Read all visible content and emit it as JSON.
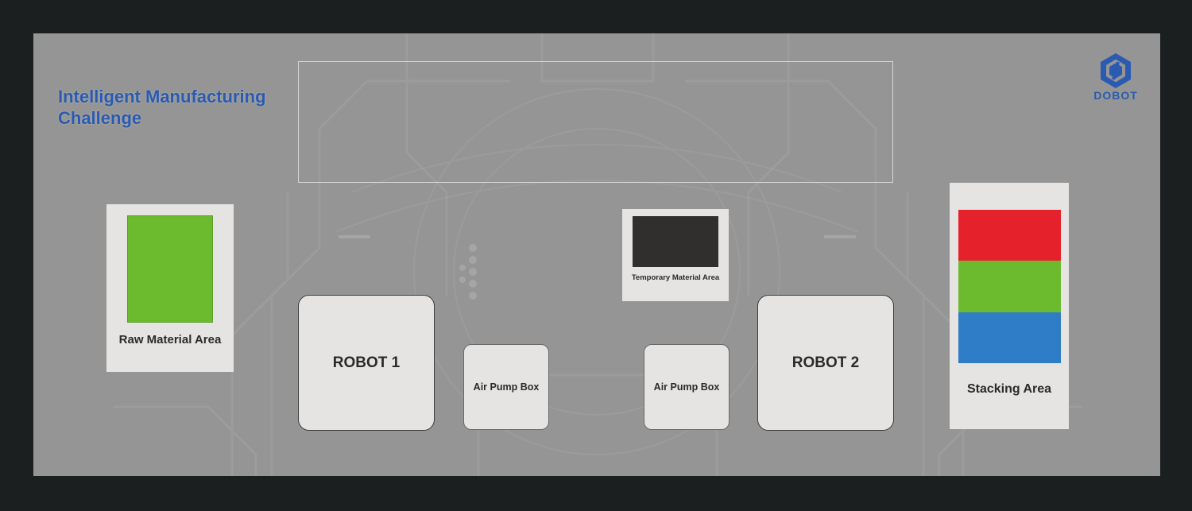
{
  "title": {
    "line1": "Intelligent Manufacturing",
    "line2": "Challenge"
  },
  "logo": {
    "text": "DOBOT",
    "color": "#2a5bb0",
    "icon": "dobot-hexagon-icon"
  },
  "colors": {
    "board": "#959595",
    "raw_material": "#6cba2e",
    "temporary_material": "#302f2d",
    "stack_red": "#e5212b",
    "stack_green": "#6cba2e",
    "stack_blue": "#2f7dc6"
  },
  "areas": {
    "raw_material": "Raw Material Area",
    "temporary_material": "Temporary Material Area",
    "stacking": "Stacking Area"
  },
  "robots": {
    "robot1": "ROBOT 1",
    "robot2": "ROBOT 2"
  },
  "pumps": {
    "pump1": "Air Pump Box",
    "pump2": "Air Pump Box"
  },
  "stack_colors": [
    "red",
    "green",
    "blue"
  ]
}
